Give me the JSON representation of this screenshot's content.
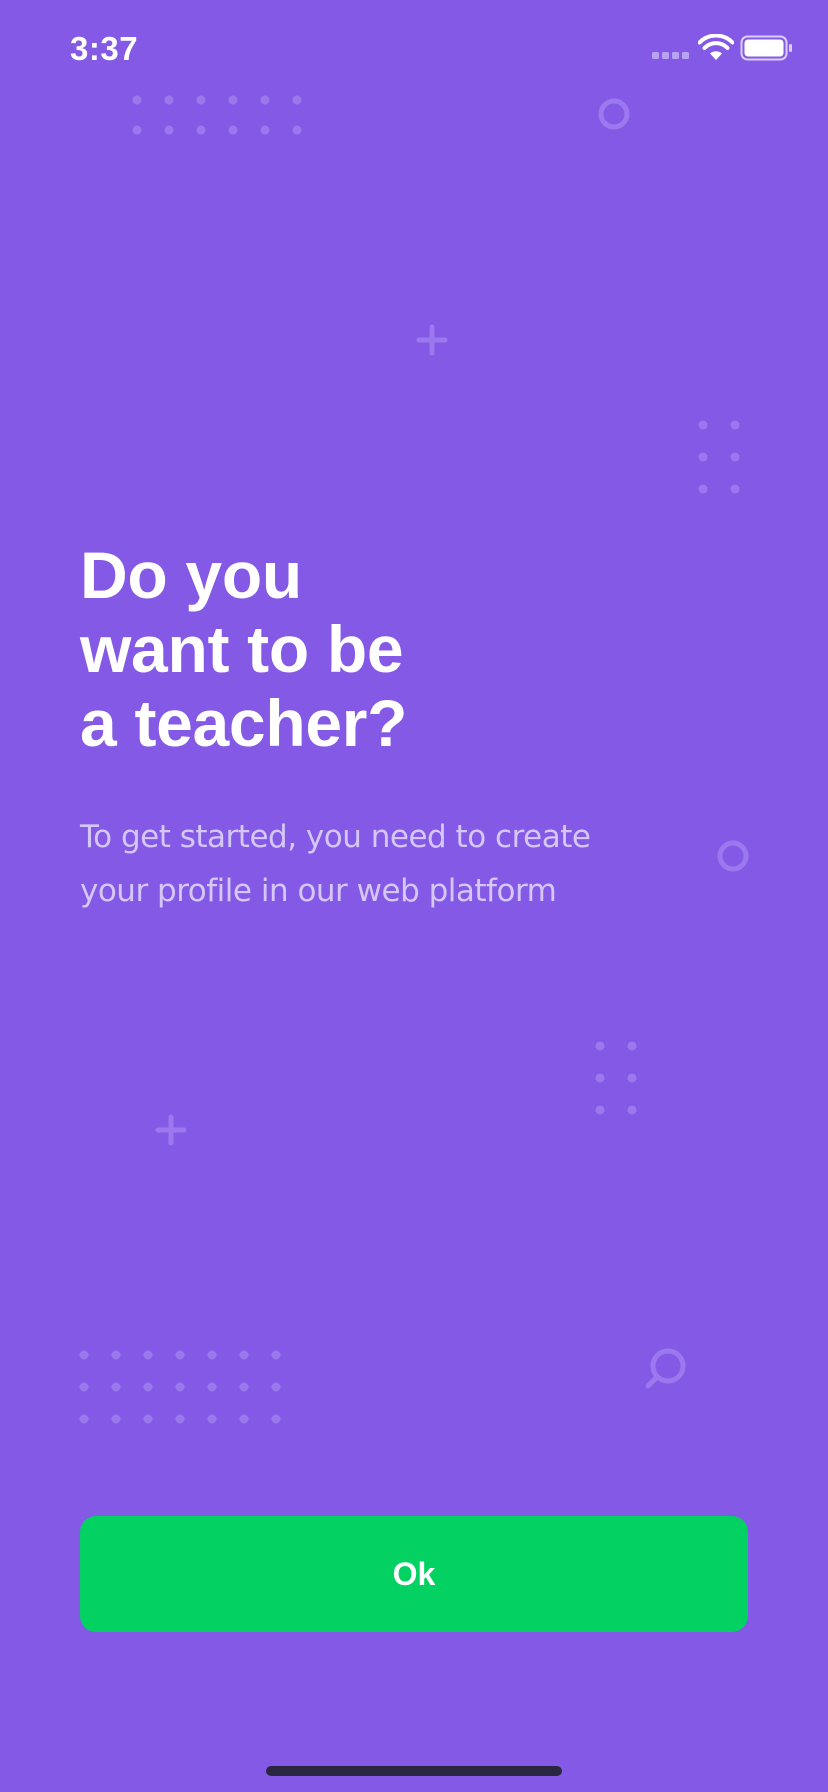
{
  "colors": {
    "background": "#8459e6",
    "button": "#03d262",
    "decor": "#9c78ef"
  },
  "status_bar": {
    "time": "3:37",
    "signal_icon": "cellular-signal-icon",
    "wifi_icon": "wifi-icon",
    "battery_icon": "battery-full-icon"
  },
  "onboarding": {
    "title_lines": [
      "Do you",
      "want to be",
      "a teacher?"
    ],
    "description": "To get started, you need to create your profile in our web platform"
  },
  "actions": {
    "ok_label": "Ok"
  }
}
